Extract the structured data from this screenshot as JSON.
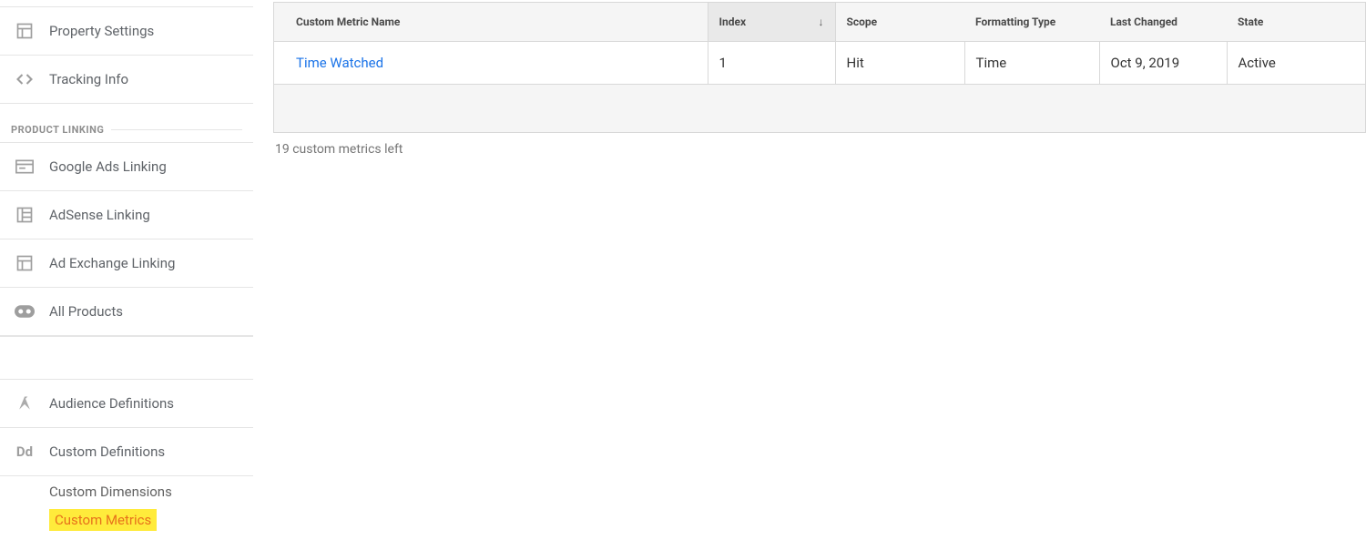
{
  "sidebar": {
    "property_settings": "Property Settings",
    "tracking_info": "Tracking Info",
    "section_product_linking": "PRODUCT LINKING",
    "google_ads_linking": "Google Ads Linking",
    "adsense_linking": "AdSense Linking",
    "ad_exchange_linking": "Ad Exchange Linking",
    "all_products": "All Products",
    "audience_definitions": "Audience Definitions",
    "custom_definitions": "Custom Definitions",
    "custom_dimensions": "Custom Dimensions",
    "custom_metrics": "Custom Metrics"
  },
  "table": {
    "headers": {
      "name": "Custom Metric Name",
      "index": "Index",
      "scope": "Scope",
      "formatting_type": "Formatting Type",
      "last_changed": "Last Changed",
      "state": "State"
    },
    "rows": [
      {
        "name": "Time Watched",
        "index": "1",
        "scope": "Hit",
        "formatting_type": "Time",
        "last_changed": "Oct 9, 2019",
        "state": "Active"
      }
    ]
  },
  "hint": "19 custom metrics left"
}
